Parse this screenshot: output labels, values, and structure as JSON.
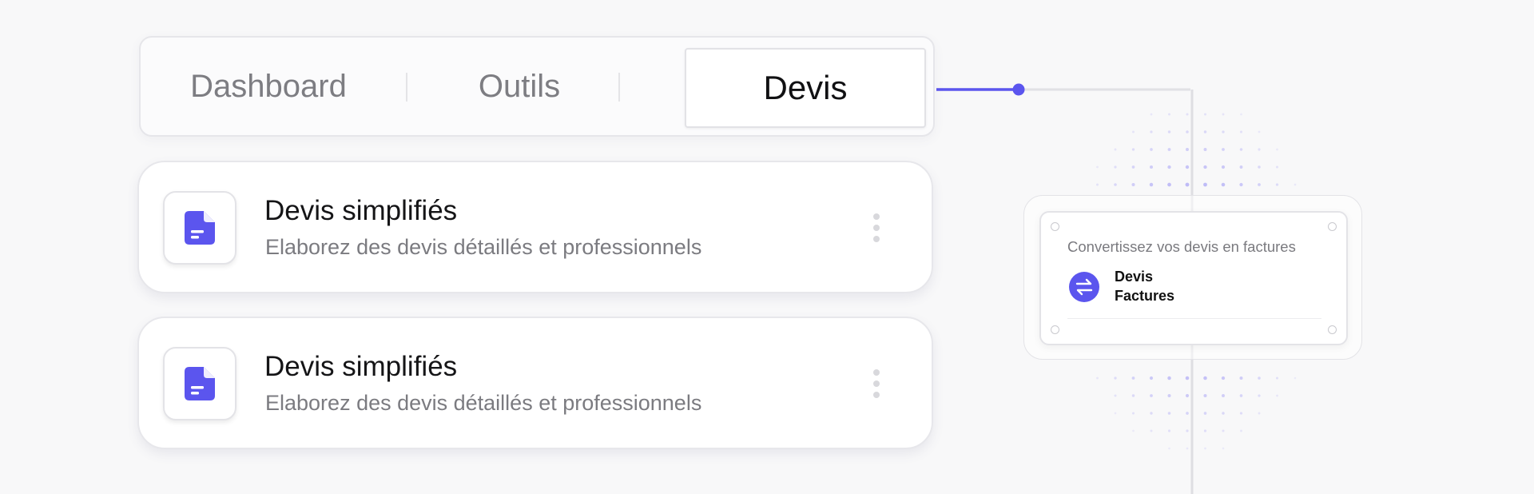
{
  "tabs": {
    "items": [
      {
        "label": "Dashboard"
      },
      {
        "label": "Outils"
      },
      {
        "label": "Devis"
      }
    ],
    "active": "Devis"
  },
  "cards": [
    {
      "title": "Devis simplifiés",
      "subtitle": "Elaborez des devis détaillés et professionnels",
      "icon": "document-icon"
    },
    {
      "title": "Devis simplifiés",
      "subtitle": "Elaborez des devis détaillés et professionnels",
      "icon": "document-icon"
    }
  ],
  "info_card": {
    "title": "Convertissez vos devis en factures",
    "line1": "Devis",
    "line2": "Factures",
    "icon": "swap-arrows-icon"
  },
  "colors": {
    "accent": "#5b55ee",
    "dots": "#8f88f5"
  }
}
